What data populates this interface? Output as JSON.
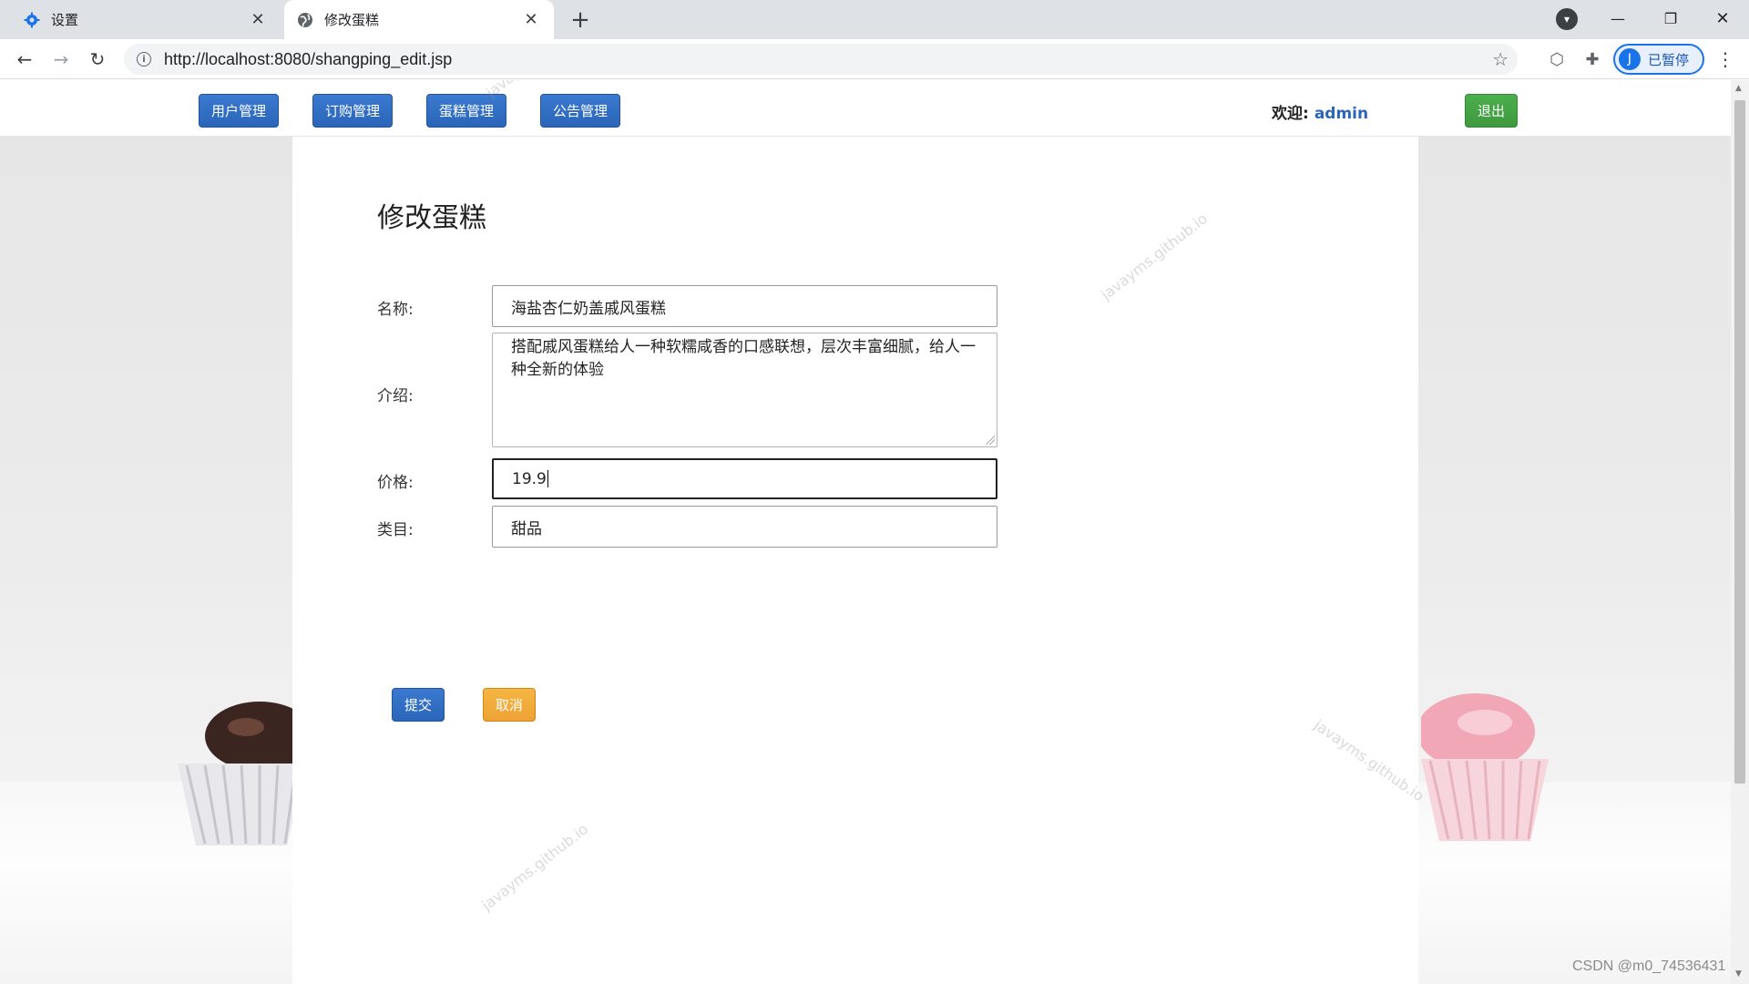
{
  "browser": {
    "tabs": [
      {
        "title": "设置",
        "icon": "gear-icon",
        "active": false
      },
      {
        "title": "修改蛋糕",
        "icon": "globe-icon",
        "active": true
      }
    ],
    "url": "http://localhost:8080/shangping_edit.jsp",
    "profile_label": "已暂停",
    "profile_initial": "J"
  },
  "nav": {
    "items": [
      "用户管理",
      "订购管理",
      "蛋糕管理",
      "公告管理"
    ],
    "welcome_label": "欢迎:",
    "username": "admin",
    "logout_label": "退出"
  },
  "form": {
    "title": "修改蛋糕",
    "name_label": "名称:",
    "name_value": "海盐杏仁奶盖戚风蛋糕",
    "intro_label": "介绍:",
    "intro_value": "搭配戚风蛋糕给人一种软糯咸香的口感联想，层次丰富细腻，给人一种全新的体验",
    "price_label": "价格:",
    "price_value": "19.9",
    "category_label": "类目:",
    "category_value": "甜品",
    "submit_label": "提交",
    "cancel_label": "取消"
  },
  "watermarks": [
    "javayms.github.io",
    "javayms.github.io",
    "javayms.github.io",
    "javayms.github.io"
  ],
  "footer_watermark": "CSDN @m0_74536431",
  "colors": {
    "primary": "#2a65b8",
    "success": "#3e9a3e",
    "warning": "#eea236"
  }
}
